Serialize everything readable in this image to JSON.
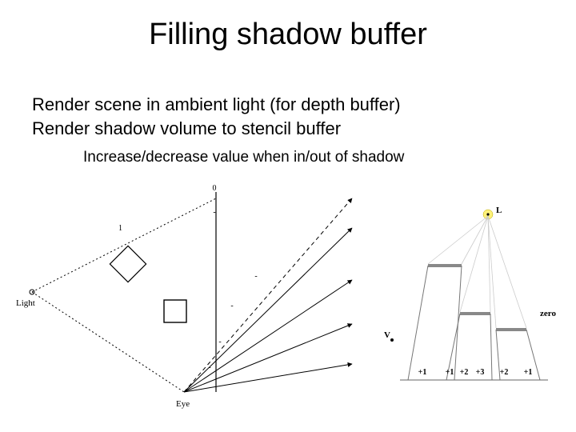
{
  "title": "Filling shadow buffer",
  "body": {
    "line1": "Render scene in ambient light (for depth buffer)",
    "line2": "Render shadow volume to stencil buffer",
    "sub": "Increase/decrease value when in/out of shadow"
  },
  "left_diagram": {
    "labels": {
      "light": "Light",
      "eye": "Eye",
      "zero": "0",
      "one": "1"
    },
    "region_values": [
      "-",
      "-",
      "-",
      "-",
      "-"
    ]
  },
  "right_diagram": {
    "labels": {
      "L": "L",
      "V": "V",
      "zero": "zero"
    },
    "region_values": [
      "+1",
      "+1",
      "+2",
      "+3",
      "+2",
      "+1"
    ]
  }
}
